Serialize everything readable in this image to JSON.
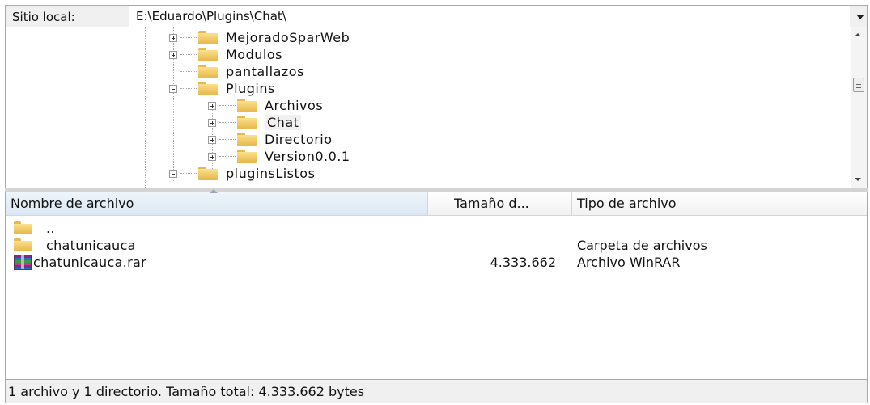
{
  "path_bar": {
    "label": "Sitio local:",
    "value": "E:\\Eduardo\\Plugins\\Chat\\"
  },
  "tree": {
    "items": [
      {
        "label": "MejoradoSparWeb",
        "expander": "plus"
      },
      {
        "label": "Modulos",
        "expander": "plus"
      },
      {
        "label": "pantallazos",
        "expander": "none"
      },
      {
        "label": "Plugins",
        "expander": "minus"
      },
      {
        "label": "Archivos",
        "expander": "plus"
      },
      {
        "label": "Chat",
        "expander": "plus",
        "selected": true
      },
      {
        "label": "Directorio",
        "expander": "plus"
      },
      {
        "label": "Version0.0.1",
        "expander": "plus"
      },
      {
        "label": "pluginsListos",
        "expander": "minus"
      }
    ]
  },
  "file_list": {
    "columns": {
      "name": "Nombre de archivo",
      "size": "Tamaño d...",
      "type": "Tipo de archivo"
    },
    "rows": [
      {
        "icon": "folder-icon",
        "name": "..",
        "size": "",
        "type": ""
      },
      {
        "icon": "folder-icon",
        "name": "chatunicauca",
        "size": "",
        "type": "Carpeta de archivos"
      },
      {
        "icon": "winrar-icon",
        "name": "chatunicauca.rar",
        "size": "4.333.662",
        "type": "Archivo WinRAR"
      }
    ]
  },
  "status": {
    "text": "1 archivo y 1 directorio. Tamaño total: 4.333.662 bytes"
  },
  "colors": {
    "folder": "#e6b548",
    "header_active": "#dbe8f3",
    "panel_bg": "#f0f0f0"
  }
}
